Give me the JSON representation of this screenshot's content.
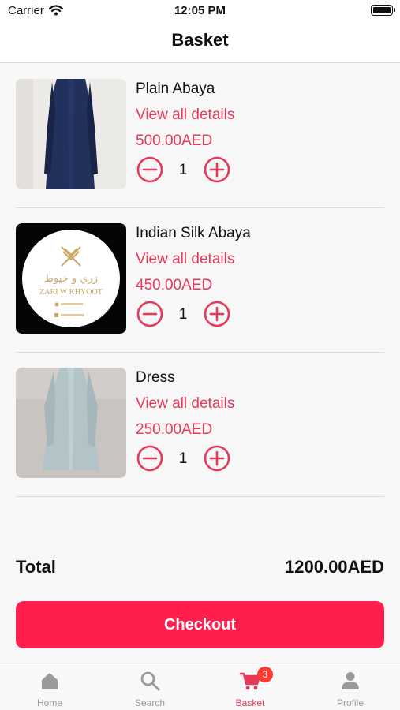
{
  "status_bar": {
    "carrier": "Carrier",
    "time": "12:05 PM"
  },
  "header": {
    "title": "Basket"
  },
  "basket": {
    "items": [
      {
        "name": "Plain Abaya",
        "link": "View all details",
        "price": "500.00AED",
        "quantity": "1"
      },
      {
        "name": "Indian Silk Abaya",
        "link": "View all details",
        "price": "450.00AED",
        "quantity": "1",
        "logo_arabic": "زري و خيوط",
        "logo_latin": "ZARI W KHYOOT"
      },
      {
        "name": "Dress",
        "link": "View all details",
        "price": "250.00AED",
        "quantity": "1"
      }
    ]
  },
  "summary": {
    "total_label": "Total",
    "total_value": "1200.00AED"
  },
  "checkout": {
    "label": "Checkout"
  },
  "tabbar": {
    "tabs": [
      {
        "label": "Home",
        "icon": "home-icon"
      },
      {
        "label": "Search",
        "icon": "search-icon"
      },
      {
        "label": "Basket",
        "icon": "cart-icon",
        "badge": "3",
        "active": true
      },
      {
        "label": "Profile",
        "icon": "person-icon"
      }
    ]
  },
  "colors": {
    "accent": "#e8385a",
    "checkout": "#ff1e4d",
    "badge": "#ff3b30",
    "inactive": "#9a9a9a"
  }
}
